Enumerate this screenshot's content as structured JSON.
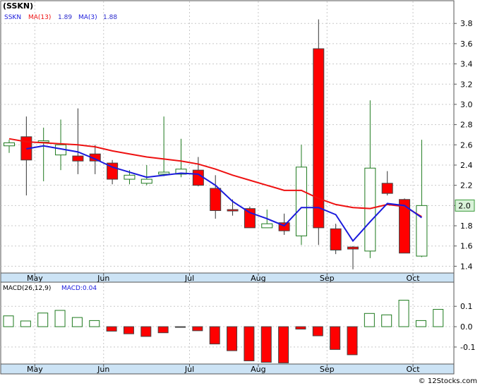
{
  "ticker_label": "(SSKN)",
  "brand": "© 12Stocks.com",
  "colors": {
    "background": "#ffffff",
    "axis_strip": "#cce3f5",
    "grid": "#c8c8c8",
    "up_candle": "#1e7a1e",
    "down_candle": "#ff0000",
    "ma13": "#ee1111",
    "ma3": "#1a1adc",
    "text_blue": "#2a2acc",
    "last_price_box": "#d9f2d9"
  },
  "chart_data": [
    {
      "type": "candlestick",
      "legend": [
        {
          "key": "ticker",
          "text": "SSKN",
          "color": "#1a1adc"
        },
        {
          "key": "ma13",
          "text": "MA(13)",
          "value": "1.89",
          "color": "#ee1111"
        },
        {
          "key": "ma3",
          "text": "MA(3)",
          "value": "1.88",
          "color": "#1a1adc"
        }
      ],
      "yticks": [
        "1.4",
        "1.6",
        "1.8",
        "2.0",
        "2.2",
        "2.4",
        "2.6",
        "2.8",
        "3.0",
        "3.2",
        "3.4",
        "3.6",
        "3.8"
      ],
      "ylim": [
        1.34,
        3.92
      ],
      "x_months": [
        {
          "label": "May",
          "week": 1
        },
        {
          "label": "Jun",
          "week": 5
        },
        {
          "label": "Jul",
          "week": 10
        },
        {
          "label": "Aug",
          "week": 14
        },
        {
          "label": "Sep",
          "week": 18
        },
        {
          "label": "Oct",
          "week": 23
        }
      ],
      "last_price": "2.0",
      "candles": [
        {
          "week": 0,
          "open": 2.59,
          "high": 2.65,
          "low": 2.52,
          "close": 2.62
        },
        {
          "week": 1,
          "open": 2.68,
          "high": 2.88,
          "low": 2.1,
          "close": 2.45
        },
        {
          "week": 2,
          "open": 2.63,
          "high": 2.77,
          "low": 2.24,
          "close": 2.64
        },
        {
          "week": 3,
          "open": 2.5,
          "high": 2.85,
          "low": 2.35,
          "close": 2.6
        },
        {
          "week": 4,
          "open": 2.49,
          "high": 2.96,
          "low": 2.31,
          "close": 2.44
        },
        {
          "week": 5,
          "open": 2.51,
          "high": 2.6,
          "low": 2.31,
          "close": 2.44
        },
        {
          "week": 6,
          "open": 2.42,
          "high": 2.45,
          "low": 2.21,
          "close": 2.26
        },
        {
          "week": 7,
          "open": 2.26,
          "high": 2.35,
          "low": 2.21,
          "close": 2.3
        },
        {
          "week": 8,
          "open": 2.22,
          "high": 2.4,
          "low": 2.2,
          "close": 2.26
        },
        {
          "week": 9,
          "open": 2.31,
          "high": 2.88,
          "low": 2.29,
          "close": 2.33
        },
        {
          "week": 10,
          "open": 2.31,
          "high": 2.66,
          "low": 2.28,
          "close": 2.36
        },
        {
          "week": 11,
          "open": 2.35,
          "high": 2.48,
          "low": 2.19,
          "close": 2.2
        },
        {
          "week": 12,
          "open": 2.17,
          "high": 2.3,
          "low": 1.87,
          "close": 1.95
        },
        {
          "week": 13,
          "open": 1.96,
          "high": 2.06,
          "low": 1.9,
          "close": 1.95
        },
        {
          "week": 14,
          "open": 1.97,
          "high": 1.99,
          "low": 1.78,
          "close": 1.78
        },
        {
          "week": 15,
          "open": 1.78,
          "high": 1.96,
          "low": 1.78,
          "close": 1.82
        },
        {
          "week": 16,
          "open": 1.83,
          "high": 1.92,
          "low": 1.71,
          "close": 1.75
        },
        {
          "week": 17,
          "open": 1.7,
          "high": 2.6,
          "low": 1.61,
          "close": 2.38
        },
        {
          "week": 18,
          "open": 3.55,
          "high": 3.84,
          "low": 1.61,
          "close": 1.78
        },
        {
          "week": 19,
          "open": 1.77,
          "high": 1.82,
          "low": 1.52,
          "close": 1.56
        },
        {
          "week": 20,
          "open": 1.59,
          "high": 1.6,
          "low": 1.37,
          "close": 1.57
        },
        {
          "week": 21,
          "open": 1.55,
          "high": 3.04,
          "low": 1.48,
          "close": 2.37
        },
        {
          "week": 22,
          "open": 2.22,
          "high": 2.34,
          "low": 2.1,
          "close": 2.12
        },
        {
          "week": 23,
          "open": 2.06,
          "high": 2.07,
          "low": 1.53,
          "close": 1.53
        },
        {
          "week": 24,
          "open": 1.5,
          "high": 2.65,
          "low": 1.49,
          "close": 2.0
        }
      ],
      "ma13": [
        {
          "week": 0,
          "value": 2.66
        },
        {
          "week": 1,
          "value": 2.63
        },
        {
          "week": 2,
          "value": 2.62
        },
        {
          "week": 3,
          "value": 2.61
        },
        {
          "week": 4,
          "value": 2.6
        },
        {
          "week": 5,
          "value": 2.58
        },
        {
          "week": 6,
          "value": 2.54
        },
        {
          "week": 7,
          "value": 2.51
        },
        {
          "week": 8,
          "value": 2.48
        },
        {
          "week": 9,
          "value": 2.46
        },
        {
          "week": 10,
          "value": 2.44
        },
        {
          "week": 11,
          "value": 2.41
        },
        {
          "week": 12,
          "value": 2.36
        },
        {
          "week": 13,
          "value": 2.3
        },
        {
          "week": 14,
          "value": 2.25
        },
        {
          "week": 15,
          "value": 2.2
        },
        {
          "week": 16,
          "value": 2.15
        },
        {
          "week": 17,
          "value": 2.15
        },
        {
          "week": 18,
          "value": 2.07
        },
        {
          "week": 19,
          "value": 2.01
        },
        {
          "week": 20,
          "value": 1.98
        },
        {
          "week": 21,
          "value": 1.97
        },
        {
          "week": 22,
          "value": 2.01
        },
        {
          "week": 23,
          "value": 1.99
        },
        {
          "week": 24,
          "value": 1.89
        }
      ],
      "ma3": [
        {
          "week": 1,
          "value": 2.56
        },
        {
          "week": 2,
          "value": 2.59
        },
        {
          "week": 3,
          "value": 2.56
        },
        {
          "week": 4,
          "value": 2.53
        },
        {
          "week": 5,
          "value": 2.46
        },
        {
          "week": 6,
          "value": 2.38
        },
        {
          "week": 7,
          "value": 2.33
        },
        {
          "week": 8,
          "value": 2.28
        },
        {
          "week": 9,
          "value": 2.3
        },
        {
          "week": 10,
          "value": 2.32
        },
        {
          "week": 11,
          "value": 2.31
        },
        {
          "week": 12,
          "value": 2.2
        },
        {
          "week": 13,
          "value": 2.04
        },
        {
          "week": 14,
          "value": 1.93
        },
        {
          "week": 15,
          "value": 1.87
        },
        {
          "week": 16,
          "value": 1.8
        },
        {
          "week": 17,
          "value": 1.98
        },
        {
          "week": 18,
          "value": 1.98
        },
        {
          "week": 19,
          "value": 1.91
        },
        {
          "week": 20,
          "value": 1.65
        },
        {
          "week": 21,
          "value": 1.84
        },
        {
          "week": 22,
          "value": 2.02
        },
        {
          "week": 23,
          "value": 2.0
        },
        {
          "week": 24,
          "value": 1.88
        }
      ]
    },
    {
      "type": "bar",
      "legend": [
        {
          "key": "macd",
          "text": "MACD(26,12,9)",
          "color": "#000000"
        },
        {
          "key": "macd_value",
          "text": "MACD:0.04",
          "color": "#1a1adc"
        }
      ],
      "yticks": [
        "0.1",
        "0.0",
        "-0.1"
      ],
      "ylim": [
        -0.18,
        0.17
      ],
      "x_months": [
        {
          "label": "May",
          "week": 1
        },
        {
          "label": "Jun",
          "week": 5
        },
        {
          "label": "Jul",
          "week": 10
        },
        {
          "label": "Aug",
          "week": 14
        },
        {
          "label": "Sep",
          "week": 18
        },
        {
          "label": "Oct",
          "week": 23
        }
      ],
      "values": [
        0.053,
        0.028,
        0.067,
        0.08,
        0.045,
        0.03,
        -0.022,
        -0.035,
        -0.048,
        -0.03,
        -0.002,
        -0.02,
        -0.085,
        -0.118,
        -0.168,
        -0.175,
        -0.178,
        -0.012,
        -0.045,
        -0.112,
        -0.138,
        0.065,
        0.058,
        0.13,
        0.03,
        0.085
      ]
    }
  ]
}
